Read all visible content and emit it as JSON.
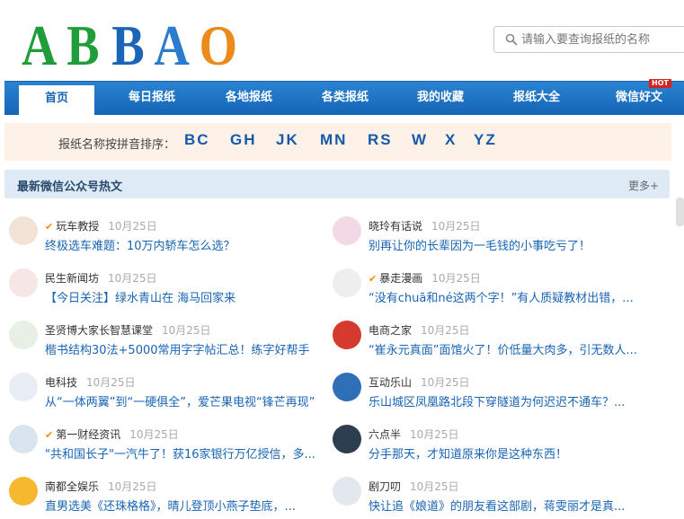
{
  "logo": {
    "text": "ABBAO"
  },
  "search": {
    "placeholder": "请输入要查询报纸的名称"
  },
  "nav": {
    "items": [
      "首页",
      "每日报纸",
      "各地报纸",
      "各类报纸",
      "我的收藏",
      "报纸大全",
      "微信好文"
    ],
    "hot_badge": "HOT"
  },
  "pinyin": {
    "label": "报纸名称按拼音排序：",
    "letters": [
      "BC",
      "GH",
      "JK",
      "MN",
      "RS",
      "W",
      "X",
      "YZ"
    ]
  },
  "section": {
    "title": "最新微信公众号热文",
    "more": "更多+"
  },
  "articles": [
    {
      "author": "玩车教授",
      "verified": true,
      "date": "10月25日",
      "title": "终极选车难题：10万内轿车怎么选？"
    },
    {
      "author": "晓玲有话说",
      "verified": false,
      "date": "10月25日",
      "title": "别再让你的长辈因为一毛钱的小事吃亏了！"
    },
    {
      "author": "民生新闻坊",
      "verified": false,
      "date": "10月25日",
      "title": "【今日关注】绿水青山在 海马回家来"
    },
    {
      "author": "暴走漫画",
      "verified": true,
      "date": "10月25日",
      "title": "“没有chuā和né这两个字！”有人质疑教材出错，..."
    },
    {
      "author": "圣贤博大家长智慧课堂",
      "verified": false,
      "date": "10月25日",
      "title": "楷书结构30法+5000常用字字帖汇总！练字好帮手"
    },
    {
      "author": "电商之家",
      "verified": false,
      "date": "10月25日",
      "title": "“崔永元真面”面馆火了！价低量大肉多，引无数人..."
    },
    {
      "author": "电科技",
      "verified": false,
      "date": "10月25日",
      "title": "从“一体两翼”到“一硬俱全”，爱芒果电视“锋芒再现”"
    },
    {
      "author": "互动乐山",
      "verified": false,
      "date": "10月25日",
      "title": "乐山城区凤凰路北段下穿隧道为何迟迟不通车？..."
    },
    {
      "author": "第一财经资讯",
      "verified": true,
      "date": "10月25日",
      "title": "\"共和国长子\"一汽牛了！获16家银行万亿授信，多..."
    },
    {
      "author": "六点半",
      "verified": false,
      "date": "10月25日",
      "title": "分手那天，才知道原来你是这种东西！"
    },
    {
      "author": "南都全娱乐",
      "verified": false,
      "date": "10月25日",
      "title": "直男选美《还珠格格》，晴儿登顶小燕子垫底，..."
    },
    {
      "author": "剧刀叨",
      "verified": false,
      "date": "10月25日",
      "title": "快让追《娘道》的朋友看这部剧，蒋雯丽才是真..."
    }
  ],
  "colors": {
    "nav": "#1a6fc4",
    "link": "#1864b4",
    "accent": "#ff8a00",
    "pinyin_bg": "#fdf1e8",
    "section_bg": "#deebf7",
    "hot": "#d6221d"
  }
}
